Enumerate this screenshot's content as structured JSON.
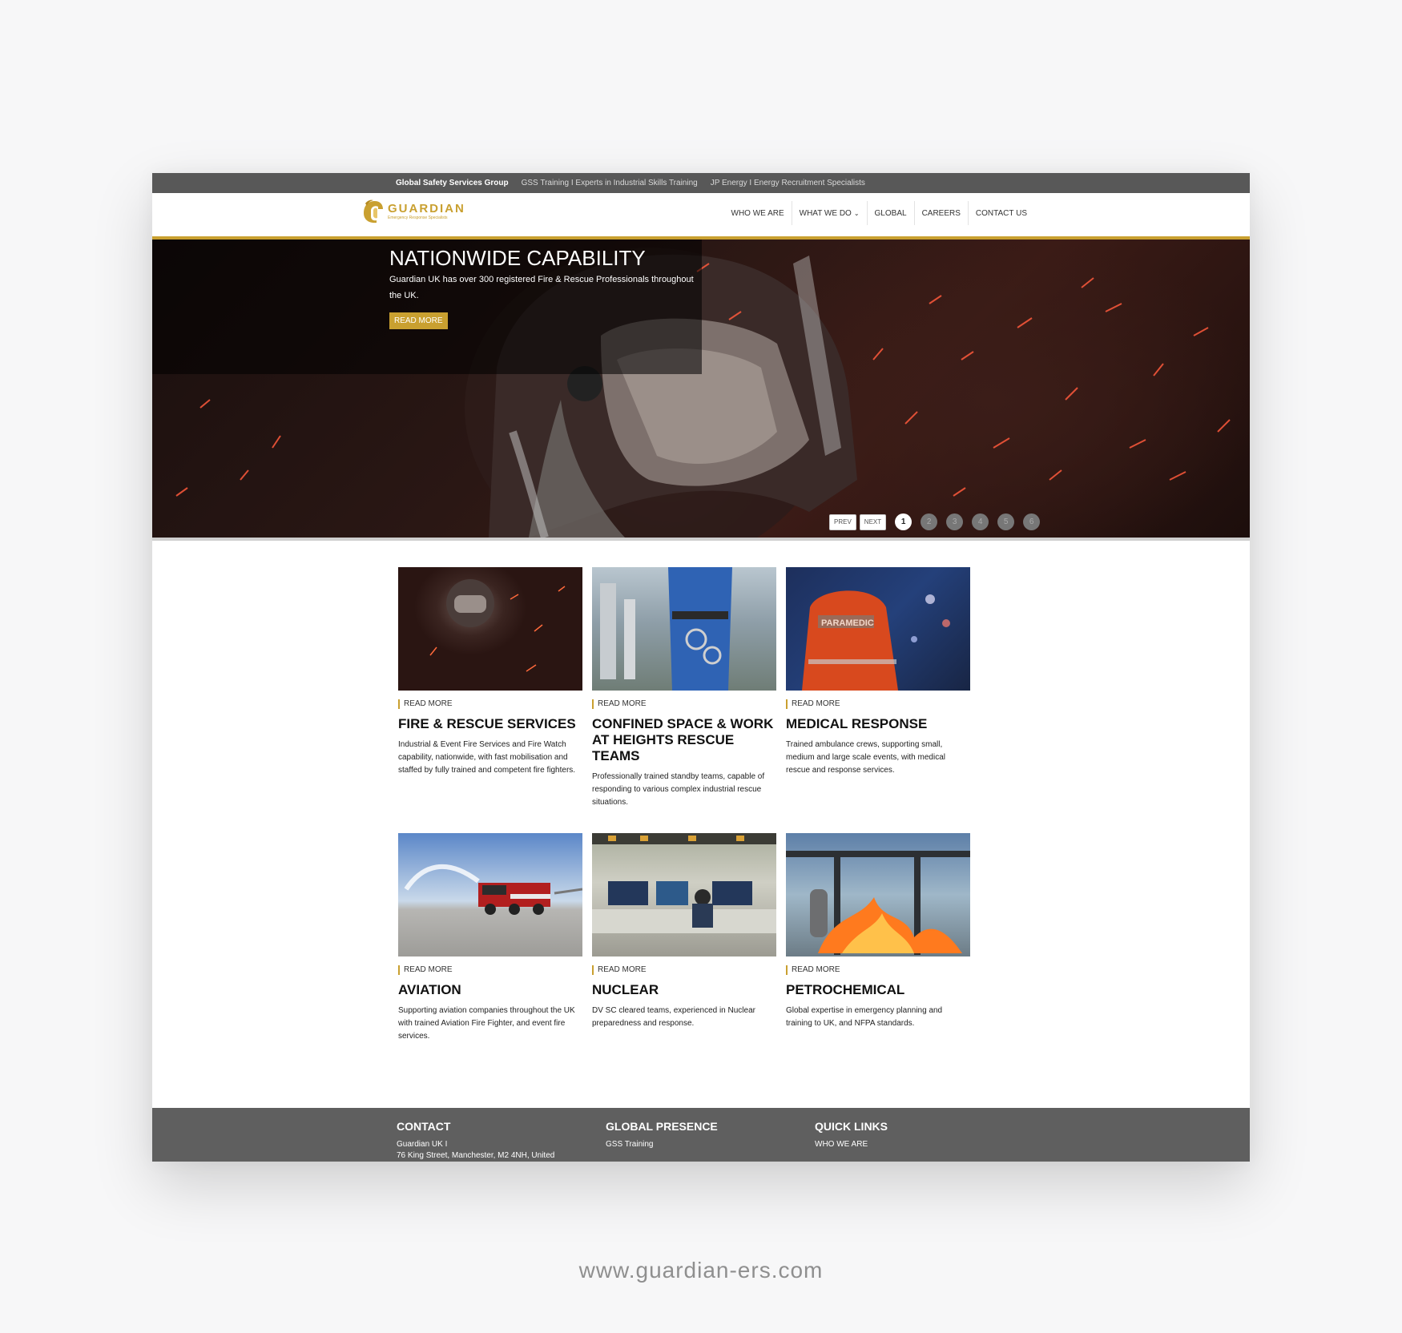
{
  "topbar": {
    "group": "Global Safety Services Group",
    "link1": "GSS Training I Experts in Industrial Skills Training",
    "link2": "JP Energy I Energy Recruitment Specialists"
  },
  "logo": {
    "name": "GUARDIAN",
    "tagline": "Emergency Response Specialists"
  },
  "nav": [
    "WHO WE ARE",
    "WHAT WE DO",
    "GLOBAL",
    "CAREERS",
    "CONTACT US"
  ],
  "hero": {
    "title": "NATIONWIDE CAPABILITY",
    "subtitle": "Guardian UK has over 300 registered Fire & Rescue Professionals throughout the UK.",
    "button": "READ MORE",
    "prev": "PREV",
    "next": "NEXT",
    "pages": [
      "1",
      "2",
      "3",
      "4",
      "5",
      "6"
    ],
    "active_page": "1"
  },
  "cards": [
    {
      "read_more": "READ MORE",
      "title": "FIRE & RESCUE SERVICES",
      "desc": "Industrial & Event Fire Services and Fire Watch capability, nationwide, with fast mobilisation and staffed by fully trained and competent fire fighters."
    },
    {
      "read_more": "READ MORE",
      "title": "CONFINED SPACE & WORK AT HEIGHTS RESCUE TEAMS",
      "desc": "Professionally trained standby teams, capable of responding to various complex industrial rescue situations."
    },
    {
      "read_more": "READ MORE",
      "title": "MEDICAL RESPONSE",
      "desc": "Trained ambulance crews, supporting small, medium and large scale events, with medical rescue and response services."
    },
    {
      "read_more": "READ MORE",
      "title": "AVIATION",
      "desc": "Supporting aviation companies throughout the UK with trained Aviation Fire Fighter, and event fire services."
    },
    {
      "read_more": "READ MORE",
      "title": "NUCLEAR",
      "desc": "DV SC cleared teams, experienced in Nuclear preparedness and response."
    },
    {
      "read_more": "READ MORE",
      "title": "PETROCHEMICAL",
      "desc": "Global expertise in emergency planning and training to UK, and NFPA standards."
    }
  ],
  "footer": {
    "contact": {
      "heading": "CONTACT",
      "line1": "Guardian UK I",
      "line2": "76 King Street, Manchester, M2 4NH, United"
    },
    "global": {
      "heading": "GLOBAL PRESENCE",
      "line1": "GSS Training"
    },
    "quick": {
      "heading": "QUICK LINKS",
      "line1": "WHO WE ARE"
    }
  },
  "site_url": "www.guardian-ers.com",
  "colors": {
    "accent": "#c9a030",
    "topbar": "#585858",
    "footer": "#5f5f5f"
  }
}
